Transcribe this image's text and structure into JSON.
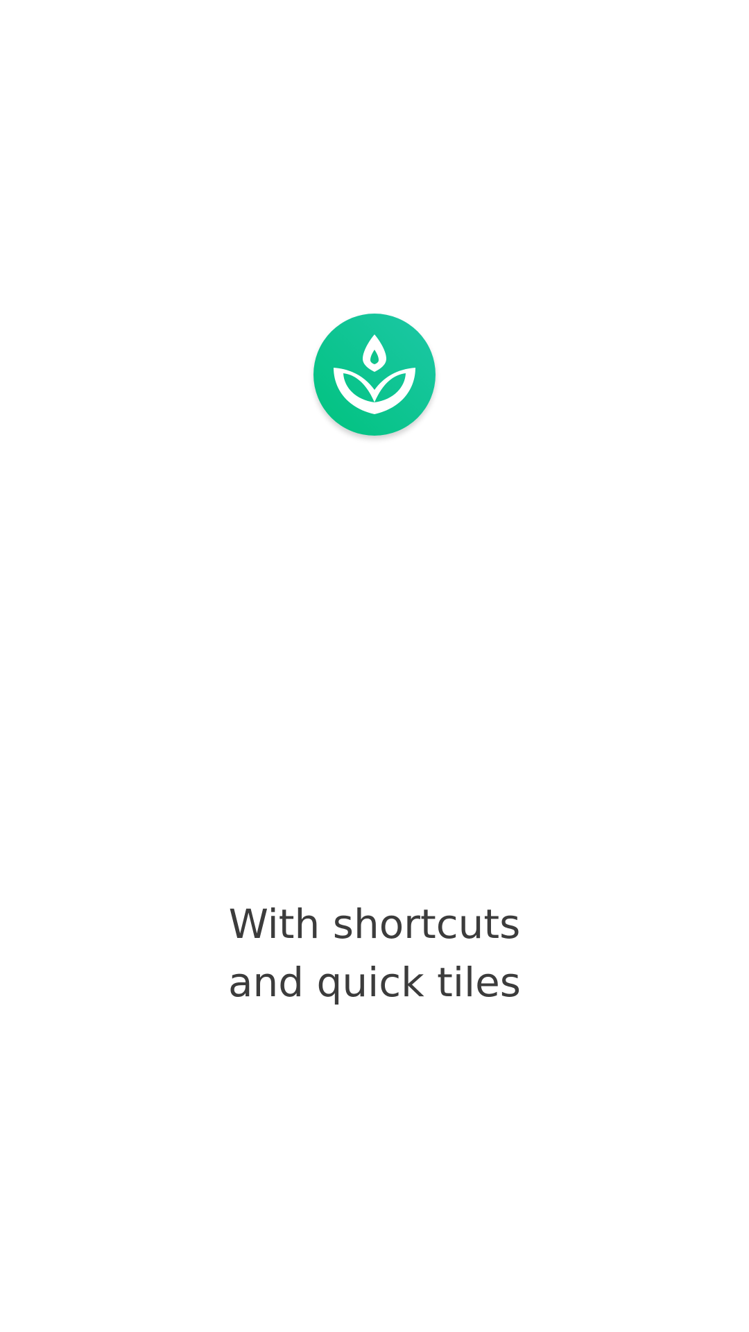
{
  "app": {
    "logo_icon": "sprout-leaves-icon",
    "logo_color_start": "#00c27e",
    "logo_color_end": "#1dc7a6"
  },
  "onboarding": {
    "caption_line_1": "With shortcuts",
    "caption_line_2": "and quick tiles"
  }
}
